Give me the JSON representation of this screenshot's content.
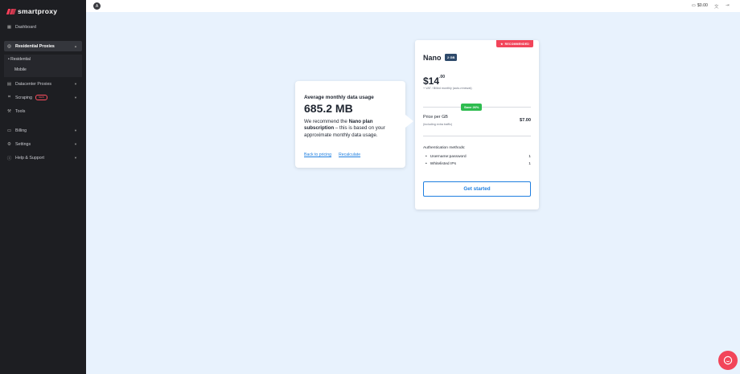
{
  "brand": {
    "name": "smartproxy",
    "accent": "#ff3f5a"
  },
  "sidebar": {
    "items": [
      {
        "label": "Dashboard",
        "icon": "dashboard-icon"
      },
      {
        "label": "Residential Proxies",
        "icon": "globe-icon",
        "expanded": true
      },
      {
        "label": "Datacenter Proxies",
        "icon": "server-icon"
      },
      {
        "label": "Scraping",
        "icon": "code-icon",
        "badge": "NEW"
      },
      {
        "label": "Tools",
        "icon": "tools-icon"
      },
      {
        "label": "Billing",
        "icon": "billing-icon"
      },
      {
        "label": "Settings",
        "icon": "settings-icon"
      },
      {
        "label": "Help & Support",
        "icon": "help-icon"
      }
    ],
    "subitems": [
      {
        "label": "Residential",
        "active": true
      },
      {
        "label": "Mobile"
      }
    ]
  },
  "topbar": {
    "avatar_initial": "A",
    "balance": "$0.00"
  },
  "usage_card": {
    "label": "Average monthly data usage",
    "value": "685.2 MB",
    "text_before": "We recommend the ",
    "text_bold": "Nano plan subscription",
    "text_after": " – this is based on your approximate monthly data usage.",
    "back_link": "Back to pricing",
    "recalc_link": "Recalculate"
  },
  "plan_card": {
    "recommended": "RECOMMENDED",
    "name": "Nano",
    "size": "2 GB",
    "price_main": "$14",
    "price_cents": ".00",
    "vat_note": "+ VAT / Billed monthly (auto-renewal)",
    "save_badge": "Save 26%",
    "price_per_gb_label": "Price per GB",
    "price_per_gb_sub": "(including extra traffic)",
    "price_per_gb_value": "$7.00",
    "auth_title": "Authentication methods:",
    "auth_methods": [
      {
        "label": "Username:password",
        "value": "1"
      },
      {
        "label": "Whitelisted IPs",
        "value": "1"
      }
    ],
    "cta": "Get started"
  },
  "colors": {
    "page_bg": "#e8f2fd",
    "sidebar_bg": "#1d1e22",
    "link": "#1f7fe0",
    "save": "#2ebc4f",
    "recommended": "#f2455a"
  }
}
